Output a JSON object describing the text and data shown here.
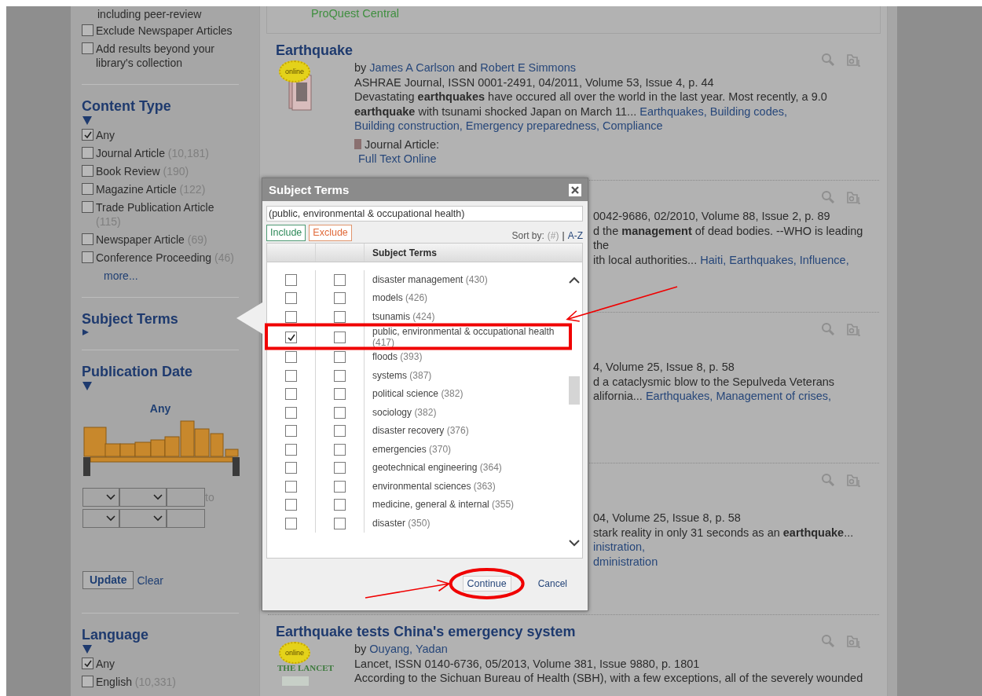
{
  "top_box": {
    "link": "ProQuest Central"
  },
  "sidebar": {
    "options": [
      {
        "kind": "text",
        "label": "including peer-review"
      },
      {
        "kind": "checkbox",
        "label": "Exclude Newspaper Articles",
        "checked": false
      },
      {
        "kind": "checkbox",
        "label": "Add results beyond your library's collection",
        "checked": false
      }
    ],
    "content_type": {
      "title": "Content Type",
      "expanded": true,
      "items": [
        {
          "label": "Any",
          "checked": true
        },
        {
          "label": "Journal Article",
          "count": "(10,181)",
          "checked": false
        },
        {
          "label": "Book Review",
          "count": "(190)",
          "checked": false
        },
        {
          "label": "Magazine Article",
          "count": "(122)",
          "checked": false
        },
        {
          "label": "Trade Publication Article",
          "count": "(115)",
          "checked": false
        },
        {
          "label": "Newspaper Article",
          "count": "(69)",
          "checked": false
        },
        {
          "label": "Conference Proceeding",
          "count": "(46)",
          "checked": false
        }
      ],
      "more": "more..."
    },
    "subject_terms": {
      "title": "Subject Terms",
      "expanded": false
    },
    "publication_date": {
      "title": "Publication Date",
      "expanded": true,
      "range_label": "Any",
      "level": 1,
      "to_label": "to",
      "update": "Update",
      "clear": "Clear"
    },
    "language": {
      "title": "Language",
      "expanded": true,
      "items": [
        {
          "label": "Any",
          "checked": true
        },
        {
          "label": "English",
          "count": "(10,331)",
          "checked": false
        }
      ]
    }
  },
  "results": [
    {
      "kind": "full",
      "title": "Earthquake",
      "badge": "online",
      "byline": [
        {
          "kind": "text",
          "text": "by"
        },
        {
          "kind": "link",
          "text": "James A Carlson"
        },
        {
          "kind": "text",
          "text": "and"
        },
        {
          "kind": "link",
          "text": "Robert E Simmons"
        }
      ],
      "source": "ASHRAE Journal, ISSN 0001-2491, 04/2011, Volume 53, Issue 4, p. 44",
      "snippet": "Devastating **earthquakes** have occured all over the world in the last year. Most recently, a 9.0 **earthquake** with tsunami shocked Japan on March 11...",
      "subjects": [
        "Earthquakes,",
        "Building codes,",
        "Building construction,",
        "Emergency preparedness,",
        "Compliance"
      ],
      "format": "Journal Article:",
      "access_link": "Full Text Online"
    },
    {
      "kind": "clipped",
      "lines": [
        {
          "text": "0042-9686, 02/2010, Volume 88, Issue 2, p. 89"
        },
        {
          "text": "d the **management** of dead bodies. --WHO is leading the"
        },
        {
          "text": "ith local authorities...",
          "subjects": [
            "Haiti,",
            "Earthquakes,",
            "Influence,"
          ]
        }
      ]
    },
    {
      "kind": "clipped",
      "lines": [
        {
          "text": "4, Volume 25, Issue 8, p. 58"
        },
        {
          "text": "d a cataclysmic blow to the Sepulveda Veterans"
        },
        {
          "text": "alifornia...",
          "subjects": [
            "Earthquakes,",
            "Management of crises,"
          ]
        }
      ]
    },
    {
      "kind": "clipped",
      "lines": [
        {
          "text": "04, Volume 25, Issue 8, p. 58"
        },
        {
          "text": "stark reality in only 31 seconds as an **earthquake**..."
        },
        {
          "subjects": [
            "inistration,"
          ]
        },
        {
          "subjects": [
            "dministration"
          ]
        }
      ]
    },
    {
      "kind": "full",
      "title": "Earthquake tests China's emergency system",
      "badge": "online",
      "cover_text": "THE LANCET",
      "byline": [
        {
          "kind": "text",
          "text": "by"
        },
        {
          "kind": "link",
          "text": "Ouyang, Yadan"
        }
      ],
      "source": "Lancet, ISSN 0140-6736, 05/2013, Volume 381, Issue 9880, p. 1801",
      "snippet": "According to the Sichuan Bureau of Health (SBH), with a few exceptions, all of the severely wounded"
    }
  ],
  "dialog": {
    "title": "Subject Terms",
    "filter_value": "(public, environmental & occupational health)",
    "include_label": "Include",
    "exclude_label": "Exclude",
    "sort_label": "Sort by:",
    "sort_options": [
      {
        "label": "(#)",
        "selected": true
      },
      {
        "label": "A-Z",
        "selected": false
      }
    ],
    "sort_separator": "|",
    "column_header": "Subject Terms",
    "terms": [
      {
        "label": "disaster management",
        "count": "(430)",
        "include": false,
        "exclude": false
      },
      {
        "label": "models",
        "count": "(426)",
        "include": false,
        "exclude": false
      },
      {
        "label": "tsunamis",
        "count": "(424)",
        "include": false,
        "exclude": false
      },
      {
        "label": "public, environmental & occupational health",
        "count": "(417)",
        "include": true,
        "exclude": false
      },
      {
        "label": "floods",
        "count": "(393)",
        "include": false,
        "exclude": false
      },
      {
        "label": "systems",
        "count": "(387)",
        "include": false,
        "exclude": false
      },
      {
        "label": "political science",
        "count": "(382)",
        "include": false,
        "exclude": false
      },
      {
        "label": "sociology",
        "count": "(382)",
        "include": false,
        "exclude": false
      },
      {
        "label": "disaster recovery",
        "count": "(376)",
        "include": false,
        "exclude": false
      },
      {
        "label": "emergencies",
        "count": "(370)",
        "include": false,
        "exclude": false
      },
      {
        "label": "geotechnical engineering",
        "count": "(364)",
        "include": false,
        "exclude": false
      },
      {
        "label": "environmental sciences",
        "count": "(363)",
        "include": false,
        "exclude": false
      },
      {
        "label": "medicine, general & internal",
        "count": "(355)",
        "include": false,
        "exclude": false
      },
      {
        "label": "disaster",
        "count": "(350)",
        "include": false,
        "exclude": false
      }
    ],
    "continue": "Continue",
    "cancel": "Cancel"
  }
}
